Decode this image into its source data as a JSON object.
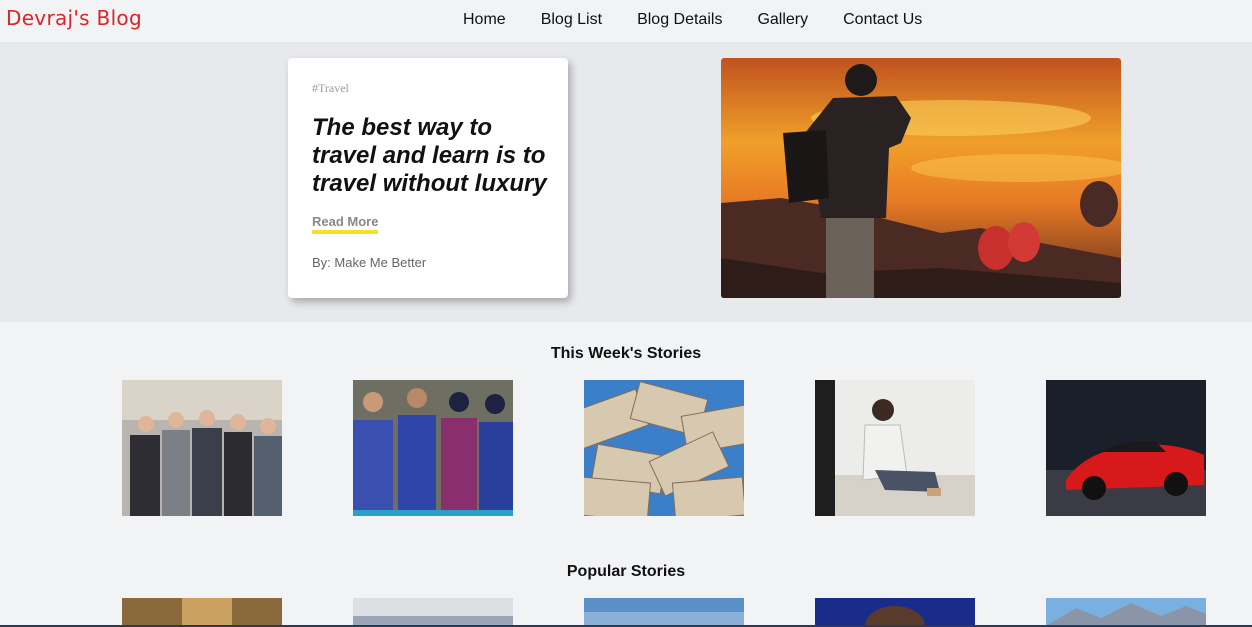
{
  "header": {
    "brand": "Devraj's Blog",
    "nav": [
      "Home",
      "Blog List",
      "Blog Details",
      "Gallery",
      "Contact Us"
    ]
  },
  "hero": {
    "tag": "#Travel",
    "headline": "The best way to travel and learn is to travel without luxury",
    "read_more": "Read More",
    "byline": "By: Make Me Better",
    "image_icon": "traveler-sunset-image"
  },
  "sections": {
    "weekly_title": "This Week's Stories",
    "popular_title": "Popular Stories"
  },
  "colors": {
    "brand": "#d8262b",
    "underline": "#f4e02a"
  }
}
